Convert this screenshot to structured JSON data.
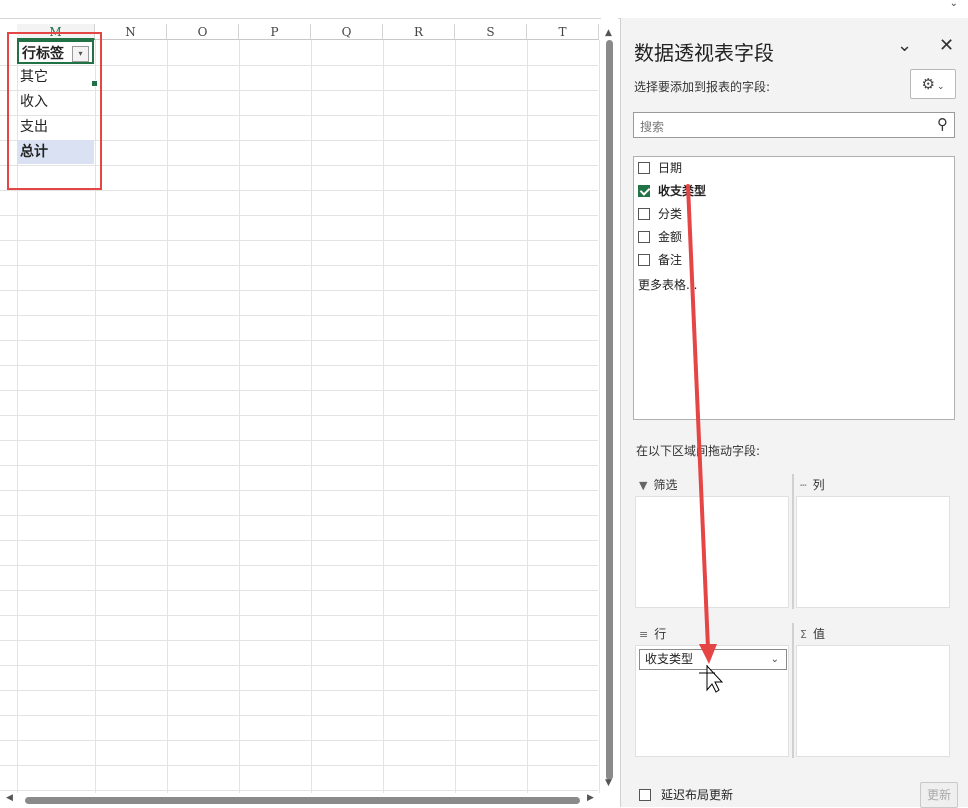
{
  "columns": [
    "M",
    "N",
    "O",
    "P",
    "Q",
    "R",
    "S",
    "T"
  ],
  "pivot": {
    "header_label": "行标签",
    "rows": [
      "其它",
      "收入",
      "支出"
    ],
    "total_label": "总计"
  },
  "pane": {
    "title": "数据透视表字段",
    "choose_label": "选择要添加到报表的字段:",
    "search_placeholder": "搜索",
    "fields": [
      {
        "label": "日期",
        "checked": false
      },
      {
        "label": "收支类型",
        "checked": true
      },
      {
        "label": "分类",
        "checked": false
      },
      {
        "label": "金额",
        "checked": false
      },
      {
        "label": "备注",
        "checked": false
      }
    ],
    "more_tables": "更多表格...",
    "drag_label": "在以下区域间拖动字段:",
    "areas": {
      "filter": "筛选",
      "columns": "列",
      "rows": "行",
      "values": "值"
    },
    "row_field": "收支类型",
    "defer_label": "延迟布局更新",
    "update_label": "更新"
  },
  "colors": {
    "accent": "#217346",
    "highlight_box": "#e64545",
    "total_fill": "#d9e1f2"
  }
}
